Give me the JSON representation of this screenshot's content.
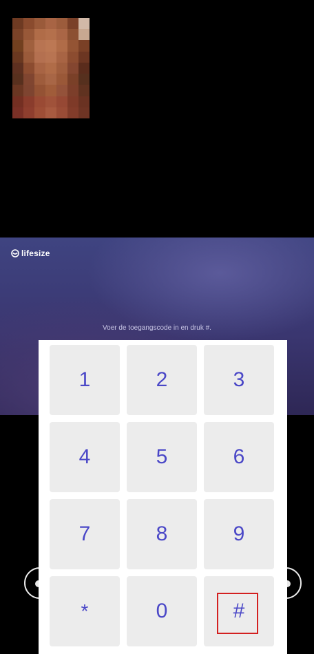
{
  "self_view": {
    "pixel_colors": [
      "#6e3a22",
      "#8a4b2e",
      "#9a5a3a",
      "#a86444",
      "#9c5c3c",
      "#7a4028",
      "#d2b9a8",
      "#7a4228",
      "#985838",
      "#b06c48",
      "#b4704c",
      "#aa6646",
      "#8c5032",
      "#c8a891",
      "#72401f",
      "#a0603e",
      "#b87452",
      "#bc7854",
      "#b06c48",
      "#945434",
      "#7a4026",
      "#6a3820",
      "#9a5a3a",
      "#b47050",
      "#b87452",
      "#a86444",
      "#8c4c30",
      "#6c3622",
      "#5e3020",
      "#8c4c30",
      "#a86444",
      "#b06c48",
      "#a05e3e",
      "#844630",
      "#5a2c1c",
      "#58301e",
      "#804530",
      "#9e5c3c",
      "#a86646",
      "#9a5838",
      "#7a4028",
      "#56301e",
      "#6a3622",
      "#7e4430",
      "#945234",
      "#a05c3a",
      "#94523a",
      "#7c3e2a",
      "#603220",
      "#742f22",
      "#8a3c2c",
      "#9a4a34",
      "#a0523a",
      "#964834",
      "#7e3a28",
      "#6a3222",
      "#7a3026",
      "#8e3e2e",
      "#9e4e36",
      "#a85a40",
      "#9a4c36",
      "#823c2a",
      "#6e3424"
    ]
  },
  "stage": {
    "brand_name": "lifesize",
    "brand_icon": "lifesize-logo-icon",
    "prompt": "Voer de toegangscode in en druk #."
  },
  "keypad": {
    "keys": [
      "1",
      "2",
      "3",
      "4",
      "5",
      "6",
      "7",
      "8",
      "9",
      "*",
      "0",
      "#"
    ],
    "highlighted_key": "#",
    "highlight_color": "#d32020",
    "key_text_color": "#4a47c7"
  },
  "side_controls": {
    "left_icon": "circle-control-icon",
    "right_icon": "circle-control-icon"
  }
}
